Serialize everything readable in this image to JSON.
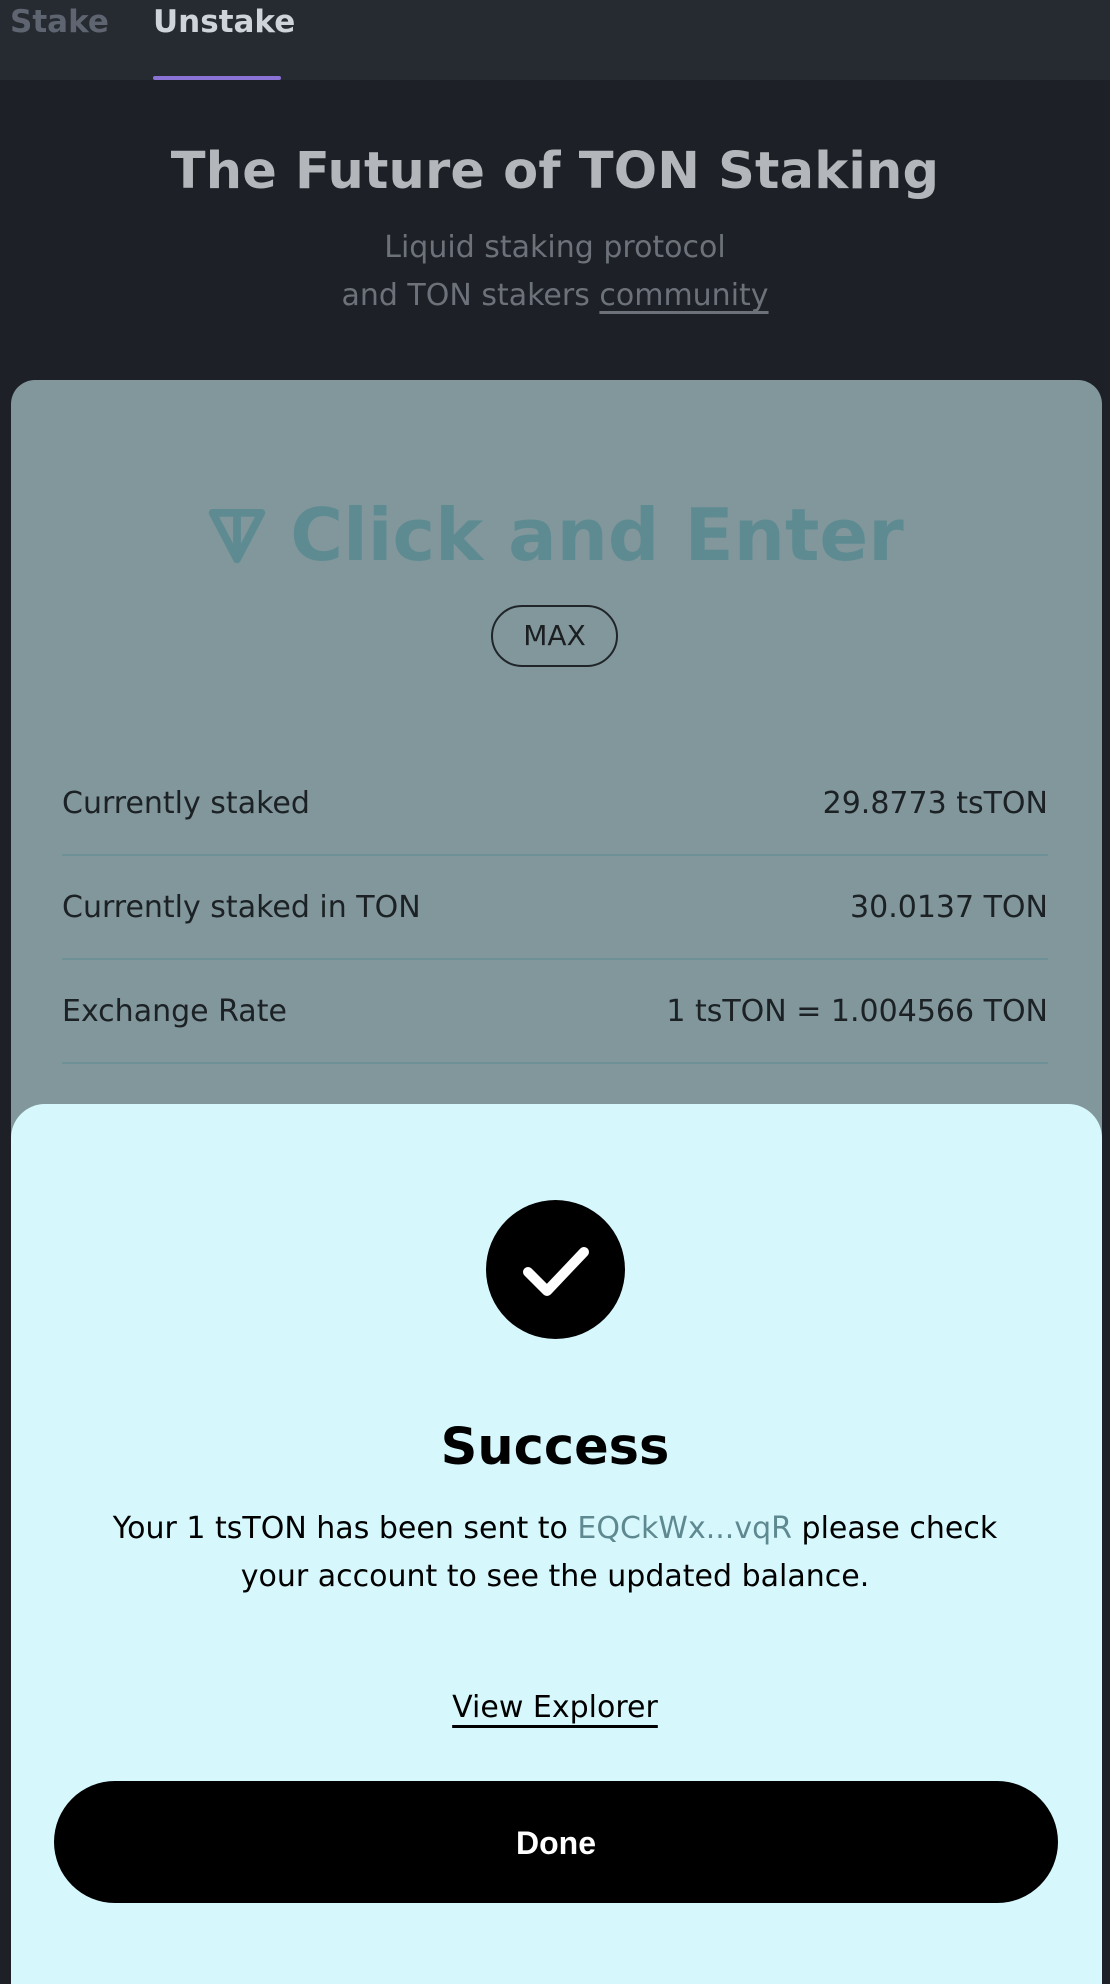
{
  "tabs": {
    "stake": "Stake",
    "unstake": "Unstake",
    "active": "unstake"
  },
  "hero": {
    "title": "The Future of TON Staking",
    "subtitle_line1": "Liquid staking protocol",
    "subtitle_line2_prefix": "and TON stakers ",
    "subtitle_link": "community"
  },
  "card": {
    "amount_icon": "ton-logo-icon",
    "amount_placeholder": "Click and Enter",
    "max_label": "MAX",
    "stats": [
      {
        "label": "Currently staked",
        "value": "29.8773 tsTON"
      },
      {
        "label": "Currently staked in TON",
        "value": "30.0137 TON"
      },
      {
        "label": "Exchange Rate",
        "value": "1 tsTON = 1.004566 TON"
      }
    ]
  },
  "success": {
    "icon": "checkmark-icon",
    "title": "Success",
    "message_prefix": "Your 1 tsTON has been sent to ",
    "address": "EQCkWx...vqR",
    "message_suffix": " please check your account to see the updated balance.",
    "explorer_label": "View Explorer",
    "done_label": "Done"
  },
  "colors": {
    "accent": "#8b73d6",
    "background": "#1d2026",
    "card": "#81979b",
    "sheet": "#d6f8fd",
    "address": "#5f8990"
  }
}
